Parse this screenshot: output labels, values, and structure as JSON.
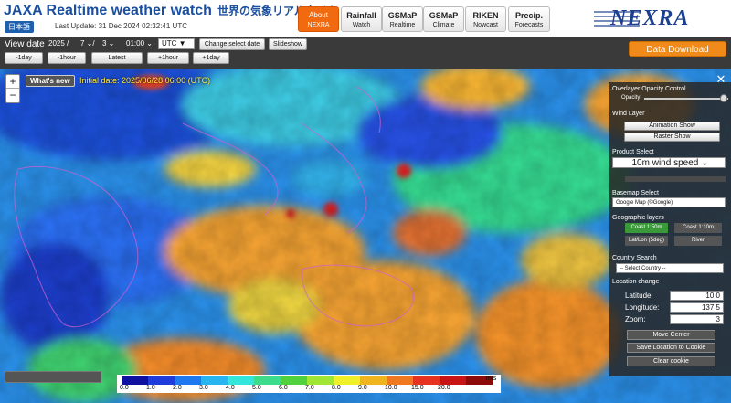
{
  "header": {
    "title": "JAXA Realtime weather watch",
    "title_jp": "世界の気象リアルタイム",
    "lang_button": "日本語",
    "last_update": "Last Update: 31 Dec 2024 02:32:41 UTC",
    "brand": "NEXRA",
    "tabs": [
      {
        "line1": "About",
        "line2": "NEXRA",
        "active": true
      },
      {
        "line1": "Rainfall",
        "line2": "Watch",
        "active": false
      },
      {
        "line1": "GSMaP",
        "line2": "Realtime",
        "active": false
      },
      {
        "line1": "GSMaP",
        "line2": "Climate",
        "active": false
      },
      {
        "line1": "RIKEN",
        "line2": "Nowcast",
        "active": false
      },
      {
        "line1": "Precip.",
        "line2": "Forecasts",
        "active": false
      }
    ]
  },
  "toolbar": {
    "view_date_label": "View date",
    "year": "2025",
    "month": "7",
    "day": "3",
    "time": "01:00",
    "tz": "UTC",
    "change_date": "Change select date",
    "slideshow": "Slideshow",
    "nav": [
      "-1day",
      "-1hour",
      "Latest",
      "+1hour",
      "+1day"
    ],
    "download": "Data Download"
  },
  "map": {
    "whats_new": "What's new",
    "initial_date": "Initial date: 2025/06/28 06:00 (UTC)",
    "zoom_in": "+",
    "zoom_out": "−"
  },
  "panel": {
    "opacity_title": "Overlayer Opacity Control",
    "opacity_label": "Opacity:",
    "opacity_value": 0.95,
    "wind_layer": "Wind Layer",
    "animation_show": "Animation Show",
    "raster_show": "Raster Show",
    "product_select": "Product Select",
    "product_value": "10m wind speed",
    "basemap_select": "Basemap Select",
    "basemap_value": "Google Map (©Google)",
    "geo_layers": "Geographic layers",
    "geo_buttons": [
      "Coast 1:50m",
      "Coast 1:10m",
      "Lat/Lon (5deg)",
      "River"
    ],
    "country_search": "Country Search",
    "country_value": "-- Select Country --",
    "location_change": "Location change",
    "latitude_label": "Latitude:",
    "latitude": "10.0",
    "longitude_label": "Longitude:",
    "longitude": "137.5",
    "zoom_label": "Zoom:",
    "zoom": "3",
    "move_center": "Move Center",
    "save_location": "Save Location to Cookie",
    "clear_cookie": "Clear cookie"
  },
  "legend": {
    "unit": "m/s",
    "labels": [
      "0.0",
      "1.0",
      "2.0",
      "3.0",
      "4.0",
      "5.0",
      "6.0",
      "7.0",
      "8.0",
      "9.0",
      "10.0",
      "15.0",
      "20.0"
    ],
    "colors": [
      "#1010a0",
      "#1e3cdc",
      "#1e78f0",
      "#28b4f0",
      "#32e6dc",
      "#3cdc8c",
      "#50d23c",
      "#a0e632",
      "#f0f028",
      "#f0b41e",
      "#f0781e",
      "#e6321e",
      "#c81414",
      "#8c0a0a"
    ]
  },
  "colors": {
    "accent": "#f26a10",
    "brand_blue": "#1c3f8f",
    "toolbar_bg": "#3a3a3a",
    "panel_bg": "#282828"
  }
}
